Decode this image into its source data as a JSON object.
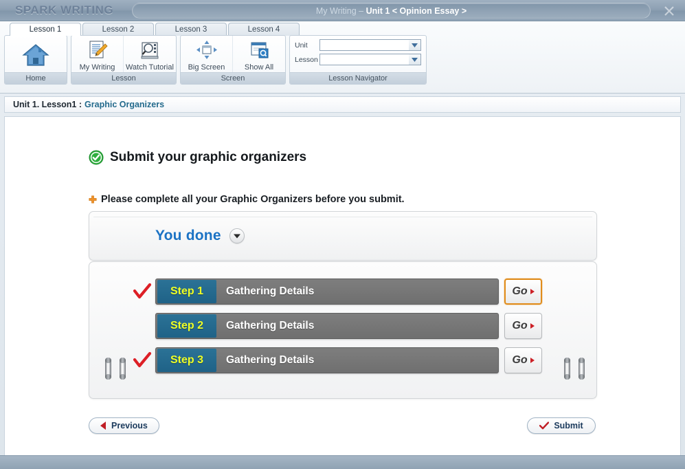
{
  "titlebar": {
    "brand": "SPARK WRITING",
    "title_lead": "My Writing  – ",
    "title_bold": "Unit 1 < Opinion Essay >",
    "close_icon": "close-icon"
  },
  "ribbon": {
    "tabs": [
      {
        "label": "Lesson 1",
        "active": true
      },
      {
        "label": "Lesson 2",
        "active": false
      },
      {
        "label": "Lesson 3",
        "active": false
      },
      {
        "label": "Lesson 4",
        "active": false
      }
    ],
    "groups": [
      {
        "label": "Home",
        "items": [
          {
            "label": "",
            "icon": "home-icon"
          }
        ]
      },
      {
        "label": "Lesson",
        "items": [
          {
            "label": "My Writing",
            "icon": "document-pencil-icon"
          },
          {
            "label": "Watch Tutorial",
            "icon": "filmstrip-magnifier-icon"
          }
        ]
      },
      {
        "label": "Screen",
        "items": [
          {
            "label": "Big Screen",
            "icon": "expand-arrows-icon"
          },
          {
            "label": "Show All",
            "icon": "windows-search-icon"
          }
        ]
      }
    ],
    "navigator": {
      "label": "Lesson Navigator",
      "unit_label": "Unit",
      "unit_value": "",
      "lesson_label": "Lesson",
      "lesson_value": "",
      "chevron_icon": "chevron-down-icon"
    }
  },
  "breadcrumb": {
    "prefix": "Unit 1. Lesson1 :",
    "current": "Graphic Organizers"
  },
  "main": {
    "heading": "Submit your graphic organizers",
    "heading_icon": "green-check-circle-icon",
    "note": "Please complete all your Graphic Organizers before you submit.",
    "note_icon": "orange-plus-icon",
    "panel_title": "You done",
    "panel_toggle_icon": "chevron-down-circle-icon",
    "steps": [
      {
        "badge": "Step 1",
        "title": "Gathering Details",
        "go_label": "Go",
        "completed": true,
        "highlighted": true
      },
      {
        "badge": "Step 2",
        "title": "Gathering Details",
        "go_label": "Go",
        "completed": false,
        "highlighted": false
      },
      {
        "badge": "Step 3",
        "title": "Gathering Details",
        "go_label": "Go",
        "completed": true,
        "highlighted": false
      }
    ],
    "previous_label": "Previous",
    "previous_icon": "chevron-left-icon",
    "submit_label": "Submit",
    "submit_icon": "check-icon"
  },
  "colors": {
    "accent_blue": "#1b72c4",
    "badge_blue": "#236a8c",
    "badge_text_yellow": "#eeff26",
    "check_red": "#cc2026",
    "highlight_orange": "#e08c1b",
    "breadcrumb_link": "#236a8c",
    "titlebar": "#8da0b3"
  }
}
